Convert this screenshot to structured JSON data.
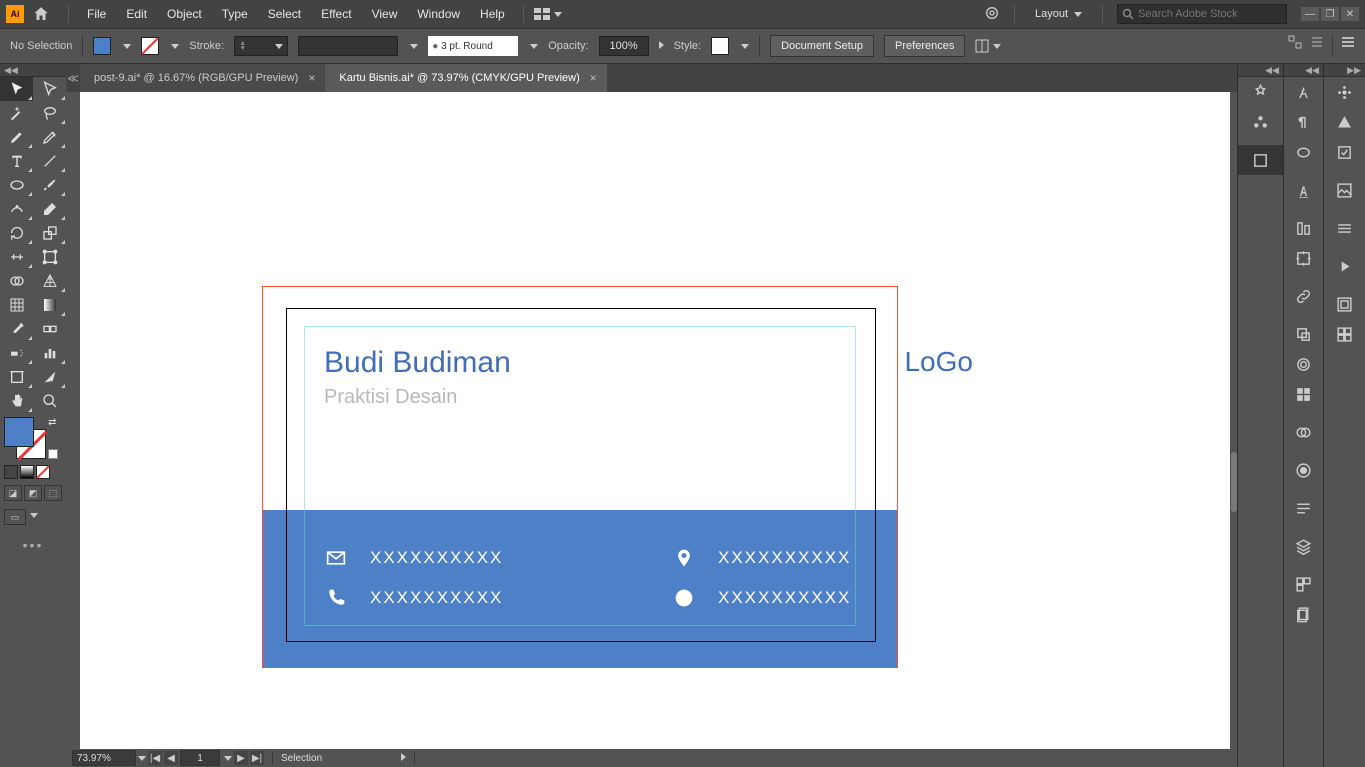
{
  "menu": {
    "items": [
      "File",
      "Edit",
      "Object",
      "Type",
      "Select",
      "Effect",
      "View",
      "Window",
      "Help"
    ],
    "workspace": "Layout",
    "search_placeholder": "Search Adobe Stock"
  },
  "control": {
    "selection_label": "No Selection",
    "stroke_label": "Stroke:",
    "stroke_weight": "",
    "brush": "3 pt. Round",
    "opacity_label": "Opacity:",
    "opacity_value": "100%",
    "style_label": "Style:",
    "btn_docsetup": "Document Setup",
    "btn_prefs": "Preferences"
  },
  "tabs": [
    {
      "label": "post-9.ai* @ 16.67% (RGB/GPU Preview)",
      "active": false
    },
    {
      "label": "Kartu Bisnis.ai* @ 73.97% (CMYK/GPU Preview)",
      "active": true
    }
  ],
  "card": {
    "name": "Budi Budiman",
    "subtitle": "Praktisi Desain",
    "logo": "LoGo",
    "contact1": "XXXXXXXXXX",
    "contact2": "XXXXXXXXXX",
    "contact3": "XXXXXXXXXX",
    "contact4": "XXXXXXXXXX"
  },
  "status": {
    "zoom": "73.97%",
    "artboard": "1",
    "tool": "Selection"
  }
}
